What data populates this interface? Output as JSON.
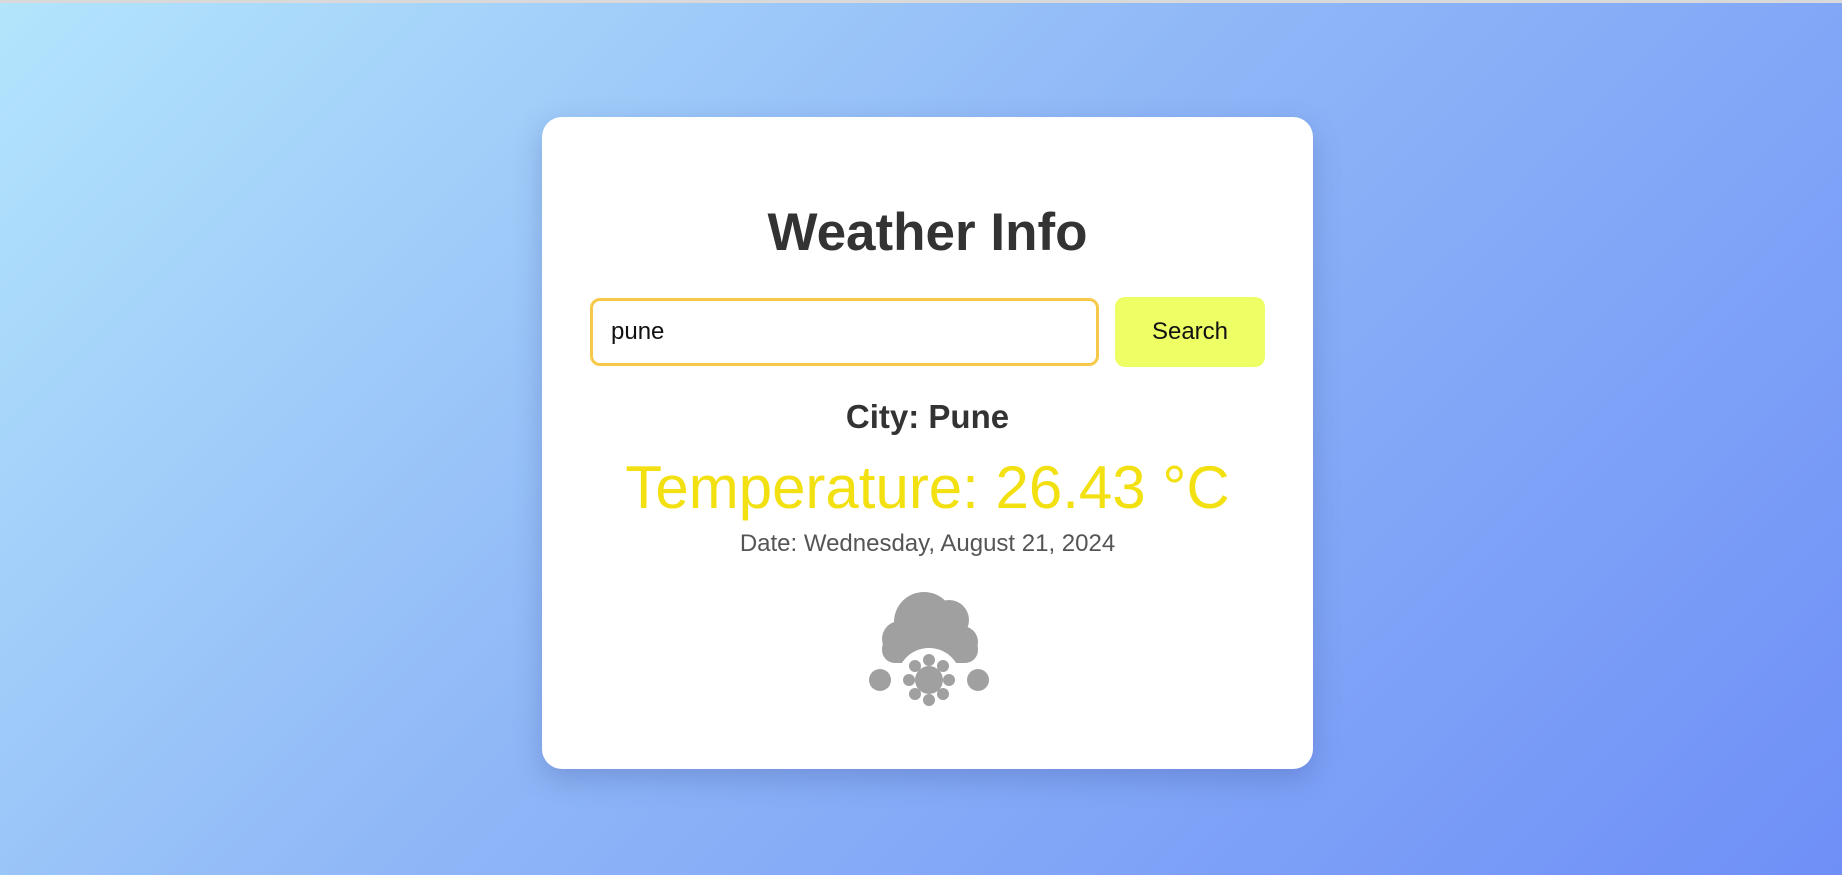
{
  "app": {
    "title": "Weather Info"
  },
  "search": {
    "value": "pune",
    "placeholder": "",
    "button_label": "Search"
  },
  "result": {
    "city_text": "City: Pune",
    "temperature_text": "Temperature: 26.43 °C",
    "date_text": "Date: Wednesday, August 21, 2024",
    "icon": "snow-cloud-icon"
  },
  "colors": {
    "background_start": "#b3e5fc",
    "background_end": "#6f8ff7",
    "input_border": "#f6c94a",
    "button_background": "#eeff66",
    "temperature": "#f3e010",
    "title": "#333333",
    "icon": "#a0a0a0"
  }
}
